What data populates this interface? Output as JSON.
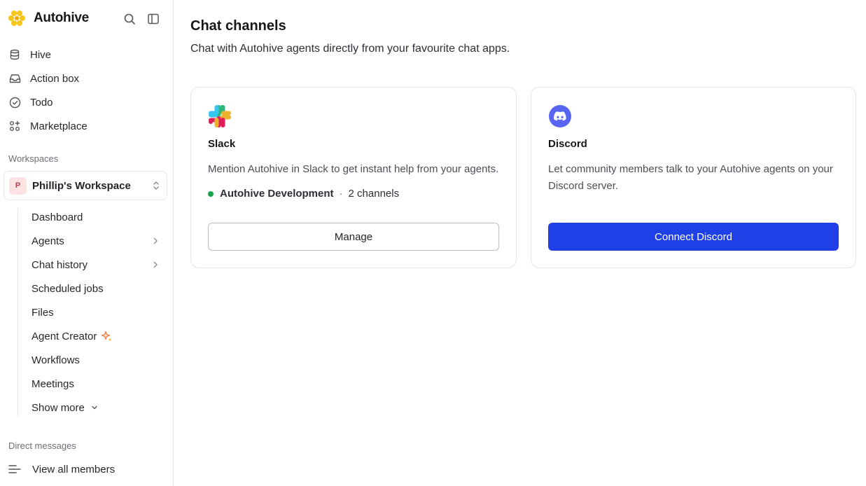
{
  "brand": {
    "name": "Autohive",
    "accent": "#f5c518"
  },
  "nav": [
    {
      "label": "Hive",
      "icon": "database-icon"
    },
    {
      "label": "Action box",
      "icon": "inbox-icon"
    },
    {
      "label": "Todo",
      "icon": "check-circle-icon"
    },
    {
      "label": "Marketplace",
      "icon": "apps-icon"
    }
  ],
  "workspaces": {
    "label": "Workspaces",
    "selected": {
      "name": "Phillip's Workspace",
      "initial": "P"
    },
    "items": [
      {
        "label": "Dashboard"
      },
      {
        "label": "Agents"
      },
      {
        "label": "Chat history"
      },
      {
        "label": "Scheduled jobs"
      },
      {
        "label": "Files"
      },
      {
        "label": "Agent Creator"
      },
      {
        "label": "Workflows"
      },
      {
        "label": "Meetings"
      },
      {
        "label": "Show more"
      }
    ]
  },
  "direct_messages": {
    "label": "Direct messages",
    "view_all": "View all members"
  },
  "page": {
    "title": "Chat channels",
    "subtitle": "Chat with Autohive agents directly from your favourite chat apps."
  },
  "cards": {
    "slack": {
      "title": "Slack",
      "description": "Mention Autohive in Slack to get instant help from your agents.",
      "status_name": "Autohive Development",
      "status_separator": "·",
      "status_detail": "2 channels",
      "button": "Manage",
      "status_color": "#16a34a"
    },
    "discord": {
      "title": "Discord",
      "description": "Let community members talk to your Autohive agents on your Discord server.",
      "button": "Connect Discord",
      "brand_color": "#5865f2",
      "button_color": "#1e40e6"
    }
  }
}
